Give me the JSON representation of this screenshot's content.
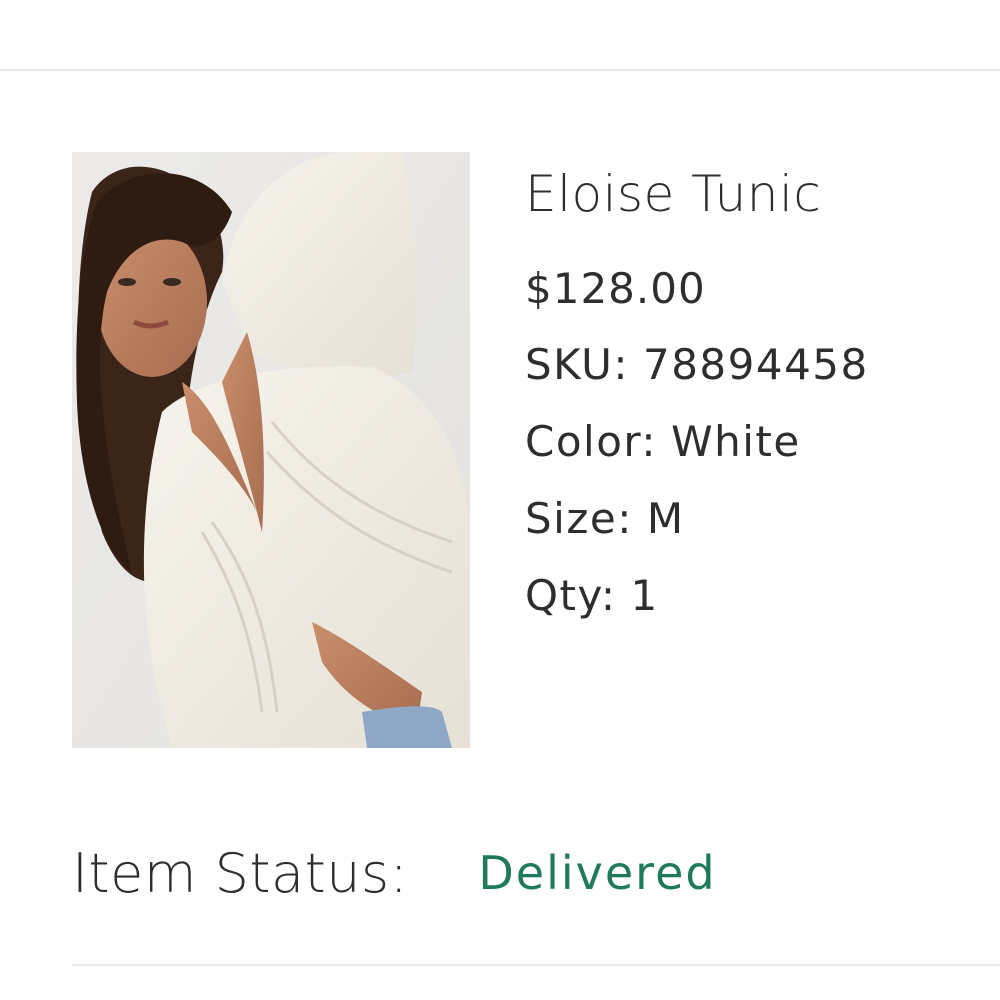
{
  "product": {
    "name": "Eloise Tunic",
    "price": "$128.00",
    "image_description_name": "product-photo",
    "sku_label": "SKU:",
    "sku": "78894458",
    "color_label": "Color:",
    "color": "White",
    "size_label": "Size:",
    "size": "M",
    "qty_label": "Qty:",
    "qty": "1"
  },
  "status": {
    "label": "Item Status:",
    "value": "Delivered",
    "value_color": "#1f7a5c"
  },
  "colors": {
    "divider": "#ebe9e6",
    "text": "#2e2e2e",
    "status_green": "#1f7a5c"
  }
}
